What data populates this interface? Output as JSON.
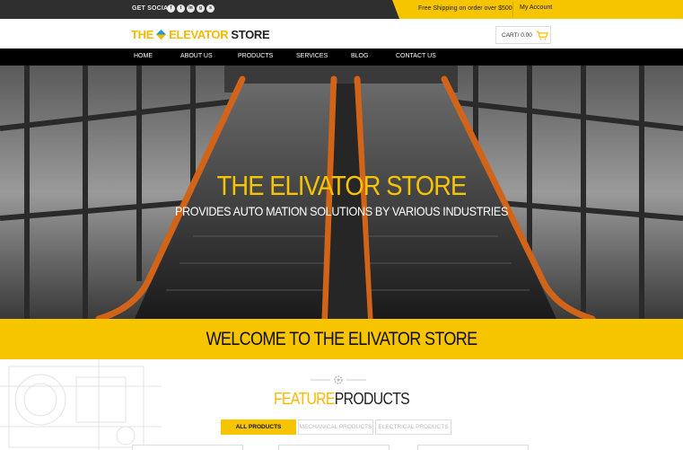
{
  "topbar": {
    "social_label": "GET SOCIAL:",
    "social_icons": [
      "facebook-icon",
      "twitter-icon",
      "linkedin-icon",
      "google-plus-icon",
      "skype-icon"
    ],
    "shipping_text": "Free Shipping on order over  $500",
    "my_account": "My Account"
  },
  "header": {
    "logo_part1": "THE",
    "logo_part2": "ELEVATOR",
    "logo_part3": "STORE",
    "cart_label": "CART/ 0.00"
  },
  "nav": {
    "items": [
      "HOME",
      "ABOUT US",
      "PRODUCTS",
      "SERVICES",
      "BLOG",
      "CONTACT US"
    ]
  },
  "hero": {
    "title": "THE ELIVATOR STORE",
    "subtitle": "PROVIDES AUTO MATION SOLUTIONS BY VARIOUS INDUSTRIES"
  },
  "welcome": {
    "text": "WELCOME TO  THE ELIVATOR STORE"
  },
  "feature": {
    "title_part1": "FEATURE",
    "title_part2": "PRODUCTS",
    "tabs": [
      "ALL PRODUCTS",
      "MECHANICAL PRODUCTS",
      "ELECTRICAL PRODUCTS"
    ]
  },
  "colors": {
    "accent": "#f7c400",
    "dark": "#2f2f2f",
    "nav": "#000000"
  }
}
